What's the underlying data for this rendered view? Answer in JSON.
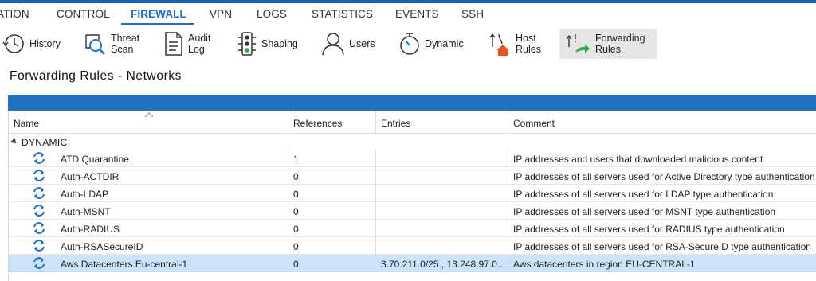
{
  "topnav": {
    "tabs": [
      {
        "label": "ATION",
        "active": false
      },
      {
        "label": "CONTROL",
        "active": false
      },
      {
        "label": "FIREWALL",
        "active": true
      },
      {
        "label": "VPN",
        "active": false
      },
      {
        "label": "LOGS",
        "active": false
      },
      {
        "label": "STATISTICS",
        "active": false
      },
      {
        "label": "EVENTS",
        "active": false
      },
      {
        "label": "SSH",
        "active": false
      }
    ],
    "accent": "#1e6fc8"
  },
  "toolbar": {
    "buttons": [
      {
        "label": "History",
        "icon": "history-icon"
      },
      {
        "label": "Threat\nScan",
        "icon": "threat-scan-icon"
      },
      {
        "label": "Audit\nLog",
        "icon": "audit-log-icon"
      },
      {
        "label": "Shaping",
        "icon": "traffic-light-icon"
      },
      {
        "label": "Users",
        "icon": "user-icon"
      },
      {
        "label": "Dynamic",
        "icon": "stopwatch-icon"
      },
      {
        "label": "Host\nRules",
        "icon": "host-rules-icon"
      },
      {
        "label": "Forwarding\nRules",
        "icon": "forwarding-rules-icon",
        "selected": true
      }
    ]
  },
  "page": {
    "title": "Forwarding Rules - Networks"
  },
  "table": {
    "columns": [
      "Name",
      "References",
      "Entries",
      "Comment"
    ],
    "group_label": "DYNAMIC",
    "rows": [
      {
        "name": "ATD Quarantine",
        "references": "1",
        "entries": "",
        "comment": "IP addresses and users that downloaded malicious content",
        "selected": false
      },
      {
        "name": "Auth-ACTDIR",
        "references": "0",
        "entries": "",
        "comment": "IP addresses of all servers used for Active Directory type authentication",
        "selected": false
      },
      {
        "name": "Auth-LDAP",
        "references": "0",
        "entries": "",
        "comment": "IP addresses of all servers used for LDAP type authentication",
        "selected": false
      },
      {
        "name": "Auth-MSNT",
        "references": "0",
        "entries": "",
        "comment": "IP addresses of all servers used for MSNT type authentication",
        "selected": false
      },
      {
        "name": "Auth-RADIUS",
        "references": "0",
        "entries": "",
        "comment": "IP addresses of all servers used for RADIUS type authentication",
        "selected": false
      },
      {
        "name": "Auth-RSASecureID",
        "references": "0",
        "entries": "",
        "comment": "IP addresses of all servers used for RSA-SecureID type authentication",
        "selected": false
      },
      {
        "name": "Aws.Datacenters.Eu-central-1",
        "references": "0",
        "entries": "3.70.211.0/25 , 13.248.97.0...",
        "comment": "Aws datacenters in region EU-CENTRAL-1",
        "selected": true
      }
    ],
    "row_icon": "sync-arrows-icon",
    "selected_row_color": "#cce4fb",
    "header_band_color": "#1e72c0"
  }
}
